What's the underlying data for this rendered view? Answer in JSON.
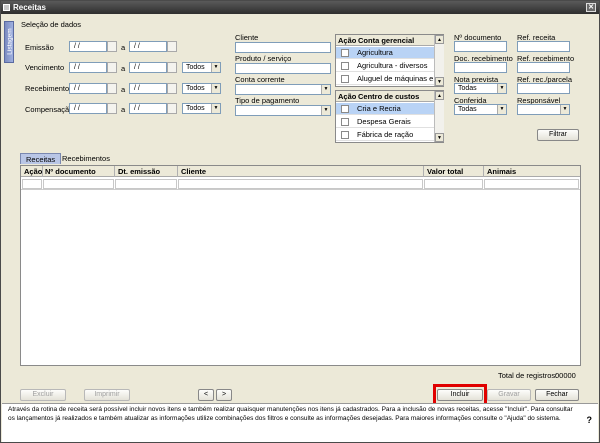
{
  "window": {
    "title": "Receitas"
  },
  "side_tab": "Listagem",
  "filter_section": {
    "title": "Seleção de dados",
    "emissao": {
      "label": "Emissão",
      "from": "/ /",
      "sep": "a",
      "to": "/ /"
    },
    "vencimento": {
      "label": "Vencimento",
      "from": "/ /",
      "sep": "a",
      "to": "/ /",
      "option": "Todos"
    },
    "recebimento": {
      "label": "Recebimento",
      "from": "/ /",
      "sep": "a",
      "to": "/ /",
      "option": "Todos"
    },
    "compensacao": {
      "label": "Compensação",
      "from": "/ /",
      "sep": "a",
      "to": "/ /",
      "option": "Todos"
    },
    "cliente_label": "Cliente",
    "produto_label": "Produto / serviço",
    "conta_corrente_label": "Conta corrente",
    "tipo_pagamento_label": "Tipo de pagamento",
    "conta_gerencial": {
      "acao_header": "Ação",
      "header": "Conta gerencial",
      "items": [
        "Agricultura",
        "Agricultura - diversos",
        "Aluguel de máquinas e e"
      ]
    },
    "centro_custos": {
      "acao_header": "Ação",
      "header": "Centro de custos",
      "items": [
        "Cria e Recria",
        "Despesa Gerais",
        "Fábrica de ração"
      ]
    },
    "n_documento_label": "Nº documento",
    "ref_receita_label": "Ref. receita",
    "doc_recebimento_label": "Doc. recebimento",
    "ref_recebimento_label": "Ref. recebimento",
    "nota_prevista": {
      "label": "Nota prevista",
      "value": "Todas"
    },
    "ref_rec_parcela_label": "Ref. rec./parcela",
    "conferida": {
      "label": "Conferida",
      "value": "Todas"
    },
    "responsavel_label": "Responsável",
    "filter_button": "Filtrar"
  },
  "tabs": [
    "Receitas",
    "Recebimentos"
  ],
  "grid": {
    "columns": [
      "Ação",
      "Nº documento",
      "Dt. emissão",
      "Cliente",
      "Valor total",
      "Animais"
    ]
  },
  "total_registros": {
    "label": "Total de registros:",
    "value": "00000"
  },
  "buttons": {
    "excluir": "Excluir",
    "imprimir": "Imprimir",
    "prev": "<",
    "next": ">",
    "incluir": "Incluir",
    "gravar": "Gravar",
    "fechar": "Fechar"
  },
  "info_text": "Através da rotina de receita será possível incluir novos itens e também realizar quaisquer manutenções nos itens já cadastrados. Para a inclusão de novas receitas, acesse \"Incluir\". Para consultar os lançamentos já realizados e também atualizar as informações utilize combinações dos filtros e consulte as informações desejadas. Para maiores informações consulte o \"Ajuda\" do sistema.",
  "help_symbol": "?",
  "colors": {
    "titlebar": "#2e2e2e",
    "highlight": "#e00000",
    "selection": "#b9d3f5"
  }
}
